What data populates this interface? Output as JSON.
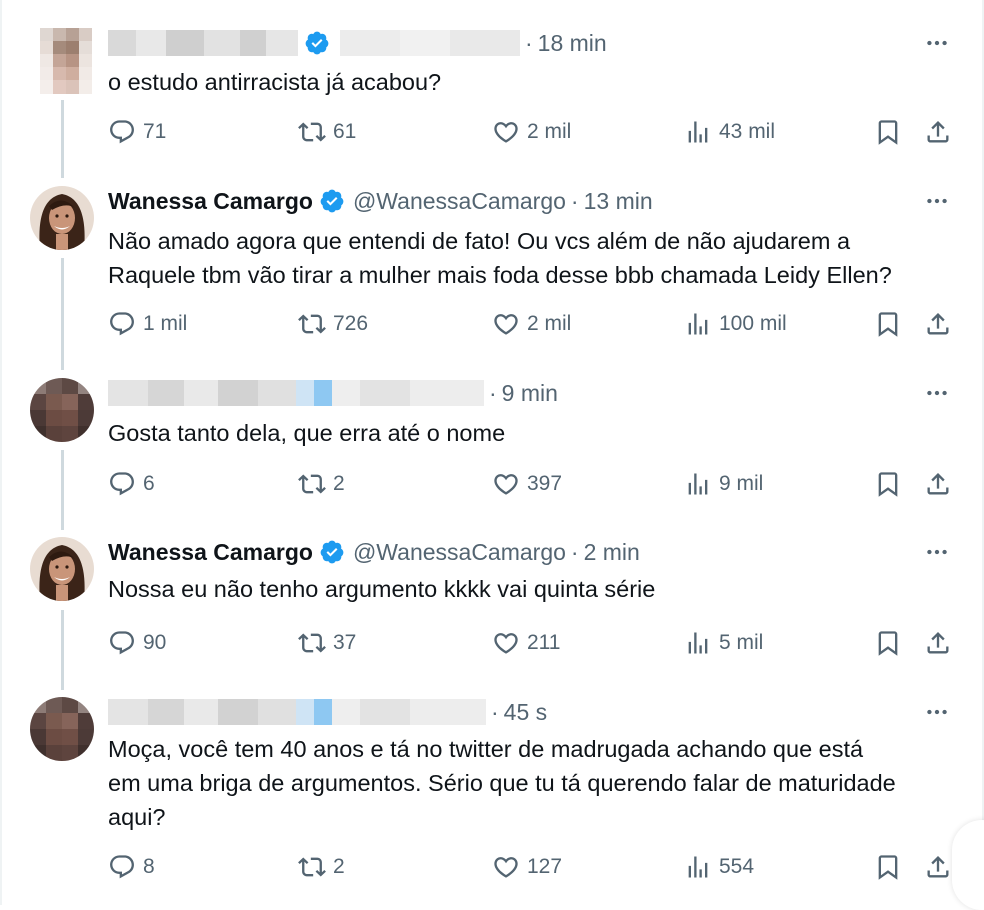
{
  "tweets": [
    {
      "user_name": "",
      "handle": "",
      "verified": true,
      "time": "18 min",
      "text": "o estudo antirracista já acabou?",
      "replies": "71",
      "retweets": "61",
      "likes": "2 mil",
      "views": "43 mil"
    },
    {
      "user_name": "Wanessa Camargo",
      "handle": "@WanessaCamargo",
      "verified": true,
      "time": "13 min",
      "text_lines": [
        "Não amado agora que entendi de fato! Ou vcs além de não ajudarem a",
        "Raquele tbm vão tirar a mulher mais foda desse bbb chamada Leidy Ellen?"
      ],
      "replies": "1 mil",
      "retweets": "726",
      "likes": "2 mil",
      "views": "100 mil"
    },
    {
      "user_name": "",
      "handle": "",
      "verified": false,
      "time": "9 min",
      "text": "Gosta tanto dela, que erra até o nome",
      "replies": "6",
      "retweets": "2",
      "likes": "397",
      "views": "9 mil"
    },
    {
      "user_name": "Wanessa Camargo",
      "handle": "@WanessaCamargo",
      "verified": true,
      "time": "2 min",
      "text": "Nossa eu não tenho argumento kkkk vai quinta série",
      "replies": "90",
      "retweets": "37",
      "likes": "211",
      "views": "5 mil"
    },
    {
      "user_name": "",
      "handle": "",
      "verified": false,
      "time": "45 s",
      "text_lines": [
        "Moça, você tem 40 anos e tá no twitter de madrugada achando que está",
        "em uma briga de argumentos. Sério que tu tá querendo falar de maturidade",
        "aqui?"
      ],
      "replies": "8",
      "retweets": "2",
      "likes": "127",
      "views": "554"
    }
  ],
  "icons": {
    "more": "more-horizontal-icon",
    "reply": "reply-icon",
    "retweet": "retweet-icon",
    "like": "heart-icon",
    "views": "views-icon",
    "bookmark": "bookmark-icon",
    "share": "share-icon",
    "verified": "verified-badge-icon"
  },
  "colors": {
    "text_primary": "#0f1419",
    "text_secondary": "#536471",
    "verified_blue": "#1d9bf0",
    "thread_line": "#cfd9de"
  }
}
